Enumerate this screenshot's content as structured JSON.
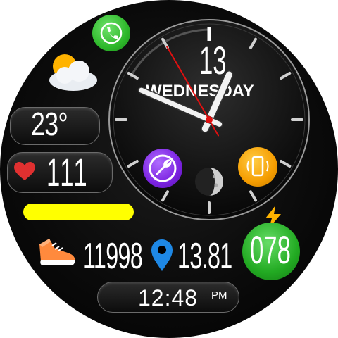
{
  "date": {
    "day_of_month": "13",
    "weekday": "WEDNESDAY"
  },
  "weather": {
    "icon": "partly-cloudy-icon",
    "temperature": "23°"
  },
  "heart_rate": {
    "icon": "heart-icon",
    "value": "111"
  },
  "battery": {
    "icon": "bolt-icon",
    "percent": "078",
    "level": 0.78,
    "bar_color": "#ffff00"
  },
  "steps": {
    "icon": "sneaker-icon",
    "value": "11998"
  },
  "distance": {
    "icon": "location-pin-icon",
    "value": "13.81"
  },
  "digital_time": {
    "time": "12:48",
    "ampm": "PM"
  },
  "analog_time": {
    "hour": 12,
    "minute": 48,
    "second": 55
  },
  "shortcuts": {
    "phone": "phone-icon",
    "settings": "wrench-icon",
    "vibrate": "vibrate-phone-icon"
  },
  "moon_phase": "moon-phase-icon",
  "colors": {
    "accent_green": "#2eb82b",
    "settings_purple": "#7a22e0",
    "vibrate_orange": "#f59d00",
    "second_hand": "#e01010"
  }
}
